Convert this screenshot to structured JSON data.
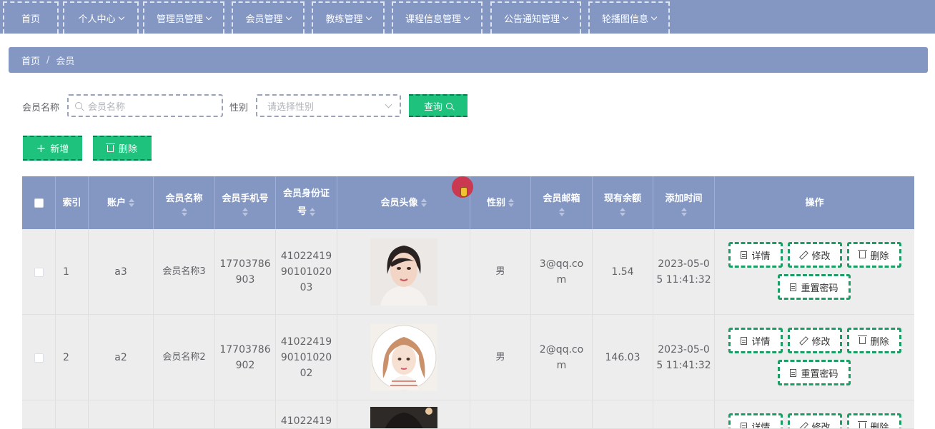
{
  "nav": {
    "items": [
      {
        "label": "首页",
        "has_dropdown": false
      },
      {
        "label": "个人中心",
        "has_dropdown": true
      },
      {
        "label": "管理员管理",
        "has_dropdown": true
      },
      {
        "label": "会员管理",
        "has_dropdown": true
      },
      {
        "label": "教练管理",
        "has_dropdown": true
      },
      {
        "label": "课程信息管理",
        "has_dropdown": true
      },
      {
        "label": "公告通知管理",
        "has_dropdown": true
      },
      {
        "label": "轮播图信息",
        "has_dropdown": true
      }
    ]
  },
  "breadcrumb": {
    "home": "首页",
    "separator": "/",
    "current": "会员"
  },
  "search": {
    "name_label": "会员名称",
    "name_placeholder": "会员名称",
    "gender_label": "性别",
    "gender_placeholder": "请选择性别",
    "query_button": "查询"
  },
  "actions": {
    "add_button": "新增",
    "delete_button": "删除"
  },
  "table": {
    "headers": {
      "index": "索引",
      "account": "账户",
      "name_l1": "会员名称",
      "phone": "会员手机号",
      "idcard_l1": "会员身份证",
      "idcard_l2": "号",
      "avatar": "会员头像",
      "gender": "性别",
      "email": "会员邮箱",
      "balance": "现有余额",
      "added": "添加时间",
      "ops": "操作"
    },
    "rows": [
      {
        "index": "1",
        "account": "a3",
        "name": "会员名称3",
        "phone_l1": "17703786",
        "phone_l2": "903",
        "id_l1": "41022419",
        "id_l2": "90101020",
        "id_l3": "03",
        "gender": "男",
        "email_l1": "3@qq.co",
        "email_l2": "m",
        "balance": "1.54",
        "time_l1": "2023-05-0",
        "time_l2": "5 11:41:32"
      },
      {
        "index": "2",
        "account": "a2",
        "name": "会员名称2",
        "phone_l1": "17703786",
        "phone_l2": "902",
        "id_l1": "41022419",
        "id_l2": "90101020",
        "id_l3": "02",
        "gender": "男",
        "email_l1": "2@qq.co",
        "email_l2": "m",
        "balance": "146.03",
        "time_l1": "2023-05-0",
        "time_l2": "5 11:41:32"
      },
      {
        "index": "",
        "account": "",
        "name": "",
        "phone_l1": "",
        "phone_l2": "",
        "id_l1": "41022419",
        "id_l2": "",
        "id_l3": "",
        "gender": "",
        "email_l1": "",
        "email_l2": "",
        "balance": "",
        "time_l1": "",
        "time_l2": ""
      }
    ],
    "op_buttons": {
      "detail": "详情",
      "edit": "修改",
      "delete": "删除",
      "reset": "重置密码"
    }
  },
  "colors": {
    "header_blue": "#8497c2",
    "green": "#1ec27c",
    "row_gray": "#ededed"
  },
  "icons": [
    "search-icon",
    "chevron-down-icon",
    "plus-icon",
    "trash-icon",
    "document-icon",
    "edit-icon",
    "sort-icon"
  ]
}
